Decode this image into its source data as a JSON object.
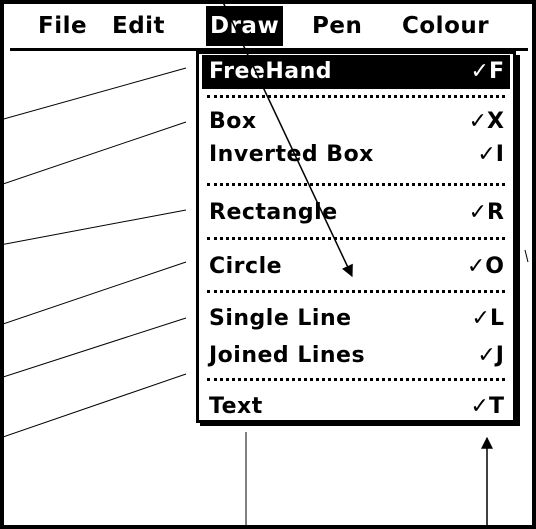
{
  "menubar": {
    "file": "File",
    "edit": "Edit",
    "draw": "Draw",
    "pen": "Pen",
    "colour": "Colour"
  },
  "draw_menu": {
    "items": [
      {
        "label": "FreeHand",
        "shortcut": "✓F",
        "selected": true
      },
      {
        "label": "Box",
        "shortcut": "✓X"
      },
      {
        "label": "Inverted Box",
        "shortcut": "✓I"
      },
      {
        "label": "Rectangle",
        "shortcut": "✓R"
      },
      {
        "label": "Circle",
        "shortcut": "✓O"
      },
      {
        "label": "Single Line",
        "shortcut": "✓L"
      },
      {
        "label": "Joined Lines",
        "shortcut": "✓J"
      },
      {
        "label": "Text",
        "shortcut": "✓T"
      }
    ]
  },
  "colors": {
    "foreground": "#000000",
    "background": "#ffffff"
  }
}
